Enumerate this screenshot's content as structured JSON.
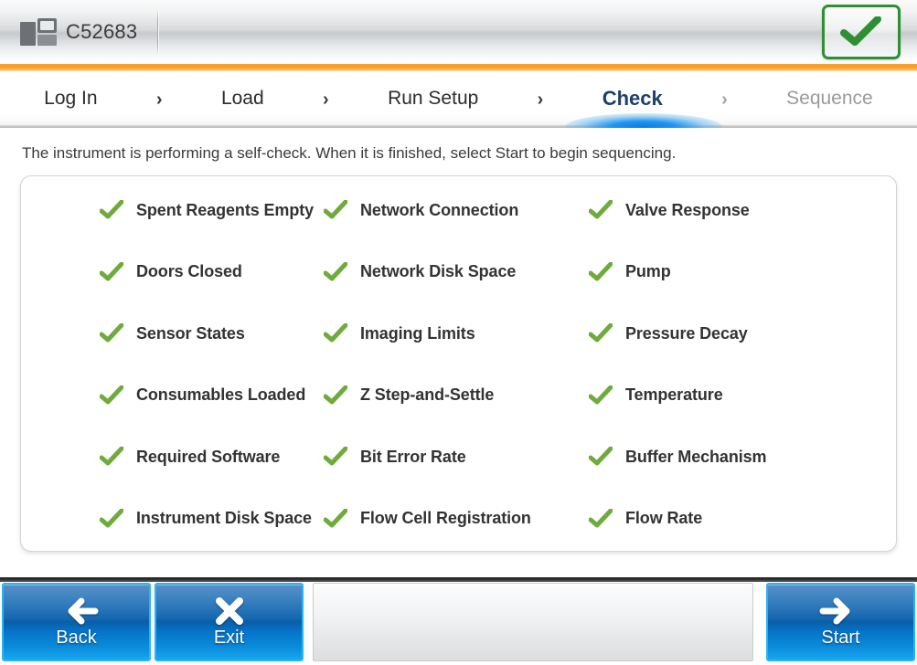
{
  "header": {
    "instrument_icon": "instrument-icon",
    "serial_number": "C52683",
    "status_icon": "green-check-icon",
    "status_color": "#2f8f33"
  },
  "nav": {
    "steps": [
      {
        "label": "Log In",
        "state": "done"
      },
      {
        "label": "Load",
        "state": "done"
      },
      {
        "label": "Run Setup",
        "state": "done"
      },
      {
        "label": "Check",
        "state": "active"
      },
      {
        "label": "Sequence",
        "state": "disabled"
      }
    ],
    "separator": "›",
    "active_color": "#1c3f6e",
    "glow_color": "#0a7fe0"
  },
  "main": {
    "instruction": "The instrument is performing a self-check. When it is finished, select Start to begin sequencing.",
    "check_icon": "green-check-icon",
    "check_color": "#6eab3c",
    "columns": [
      [
        "Spent Reagents Empty",
        "Doors Closed",
        "Sensor States",
        "Consumables Loaded",
        "Required Software",
        "Instrument Disk Space"
      ],
      [
        "Network Connection",
        "Network Disk Space",
        "Imaging Limits",
        "Z Step-and-Settle",
        "Bit Error Rate",
        "Flow Cell Registration"
      ],
      [
        "Valve Response",
        "Pump",
        "Pressure Decay",
        "Temperature",
        "Buffer Mechanism",
        "Flow Rate"
      ]
    ]
  },
  "footer": {
    "back_label": "Back",
    "back_icon": "arrow-left-icon",
    "exit_label": "Exit",
    "exit_icon": "close-x-icon",
    "start_label": "Start",
    "start_icon": "arrow-right-icon",
    "button_color": "#0a63ad",
    "button_border_color": "#27b4f5"
  }
}
